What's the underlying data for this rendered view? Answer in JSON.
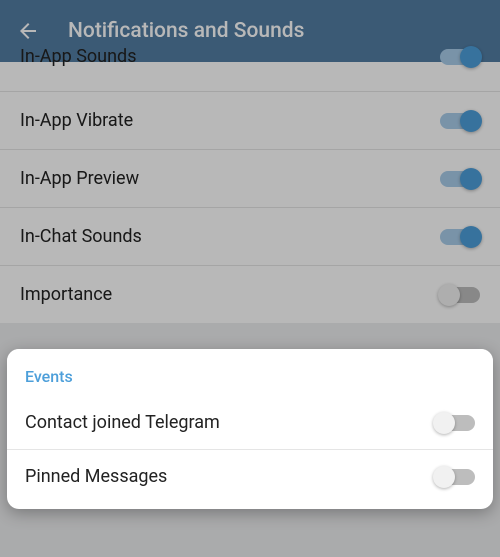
{
  "header": {
    "title": "Notifications and Sounds"
  },
  "settings": {
    "in_app_sounds": {
      "label": "In-App Sounds",
      "on": true
    },
    "in_app_vibrate": {
      "label": "In-App Vibrate",
      "on": true
    },
    "in_app_preview": {
      "label": "In-App Preview",
      "on": true
    },
    "in_chat_sounds": {
      "label": "In-Chat Sounds",
      "on": true
    },
    "importance": {
      "label": "Importance",
      "on": false
    }
  },
  "events": {
    "section_title": "Events",
    "contact_joined": {
      "label": "Contact joined Telegram",
      "on": false
    },
    "pinned_messages": {
      "label": "Pinned Messages",
      "on": false
    }
  }
}
